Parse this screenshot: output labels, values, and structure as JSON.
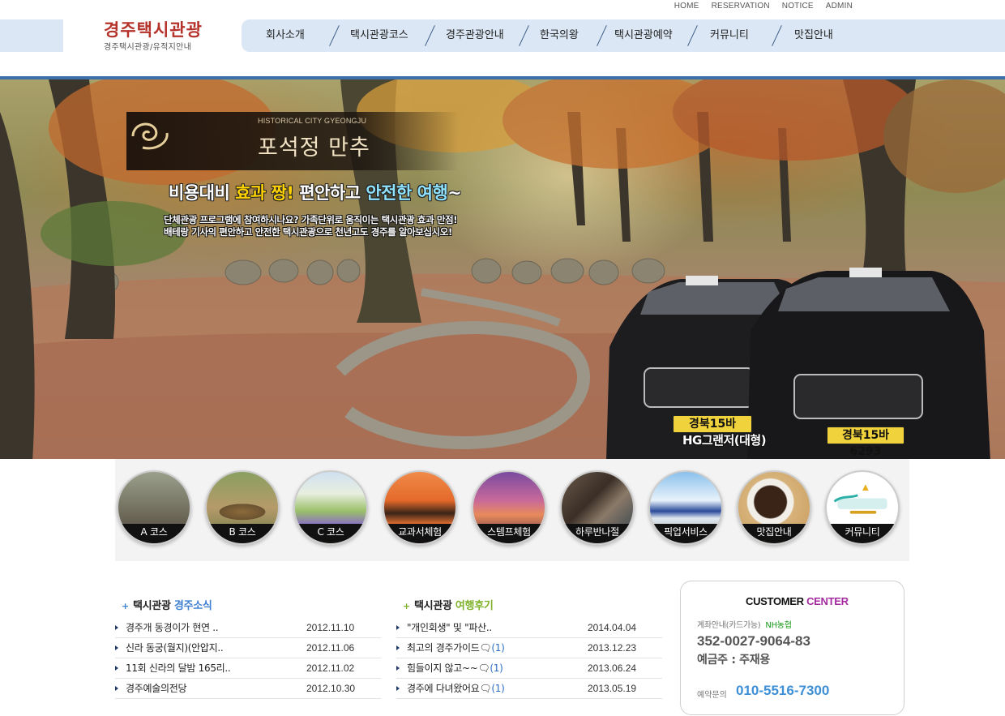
{
  "util_links": [
    "HOME",
    "RESERVATION",
    "NOTICE",
    "ADMIN"
  ],
  "logo": {
    "title": "경주택시관광",
    "subtitle": "경주택시관광/유적지안내"
  },
  "nav": [
    "회사소개",
    "택시관광코스",
    "경주관광안내",
    "한국의왕",
    "택시관광예약",
    "커뮤니티",
    "맛집안내"
  ],
  "hero": {
    "banner_sub": "HISTORICAL CITY GYEONGJU",
    "banner_title": "포석정 만추",
    "tagline": {
      "p1": "비용대비 ",
      "p2": "효과 짱!",
      "p3": " 편안하고 ",
      "p4": "안전한 여행",
      "p5": "~"
    },
    "desc1": "단체관광 프로그램에 참여하시나요? 가족단위로 움직이는 택시관광 효과 만점!",
    "desc2": "배테랑 기사의 편안하고 안전한 택시관광으로 천년고도 경주를 알아보십시오!",
    "plate_text": "경북15바 6293",
    "caption": "HG그랜저(대형)"
  },
  "quick_menu": [
    {
      "label": "A 코스",
      "icon": "a-course-photo"
    },
    {
      "label": "B 코스",
      "icon": "b-course-photo"
    },
    {
      "label": "C 코스",
      "icon": "c-course-photo"
    },
    {
      "label": "교과서체험",
      "icon": "textbook-tour-photo"
    },
    {
      "label": "스템프체험",
      "icon": "stamp-tour-photo"
    },
    {
      "label": "하루반나절",
      "icon": "half-day-photo"
    },
    {
      "label": "픽업서비스",
      "icon": "pickup-train-photo"
    },
    {
      "label": "맛집안내",
      "icon": "restaurant-photo"
    },
    {
      "label": "커뮤니티",
      "icon": "community-logo"
    }
  ],
  "news1": {
    "heading": {
      "prefix": "택시관광 ",
      "highlight": "경주소식"
    },
    "items": [
      {
        "title": "경주개 동경이가 현연 ..",
        "date": "2012.11.10"
      },
      {
        "title": "신라 동궁(월지)(안압지..",
        "date": "2012.11.06"
      },
      {
        "title": "11회 신라의 달밤 165리..",
        "date": "2012.11.02"
      },
      {
        "title": "경주예술의전당",
        "date": "2012.10.30"
      }
    ]
  },
  "news2": {
    "heading": {
      "prefix": "택시관광 ",
      "highlight": "여행후기"
    },
    "items": [
      {
        "title": "\"개인회생\" 및 \"파산..",
        "count": "",
        "date": "2014.04.04"
      },
      {
        "title": "최고의 경주가이드🗨",
        "count": "(1)",
        "date": "2013.12.23"
      },
      {
        "title": "힘들이지 않고~~🗨",
        "count": "(1)",
        "date": "2013.06.24"
      },
      {
        "title": "경주에 다녀왔어요🗨",
        "count": "(1)",
        "date": "2013.05.19"
      }
    ]
  },
  "customer_center": {
    "title_a": "CUSTOMER ",
    "title_b": "CENTER",
    "account_label": "계좌안내(카드가능)",
    "bank": "NH농협",
    "account_number": "352-0027-9064-83",
    "owner": "예금주 : 주재용",
    "reserve_label": "예약문의",
    "phone": "010-5516-7300"
  },
  "colors": {
    "nav_band": "#dbe7f5",
    "logo_red": "#b5322b",
    "hero_border": "#3d6fa8",
    "news1_highlight": "#3f7fd0",
    "news2_highlight": "#7fb12a",
    "phone": "#3d8fd6"
  }
}
